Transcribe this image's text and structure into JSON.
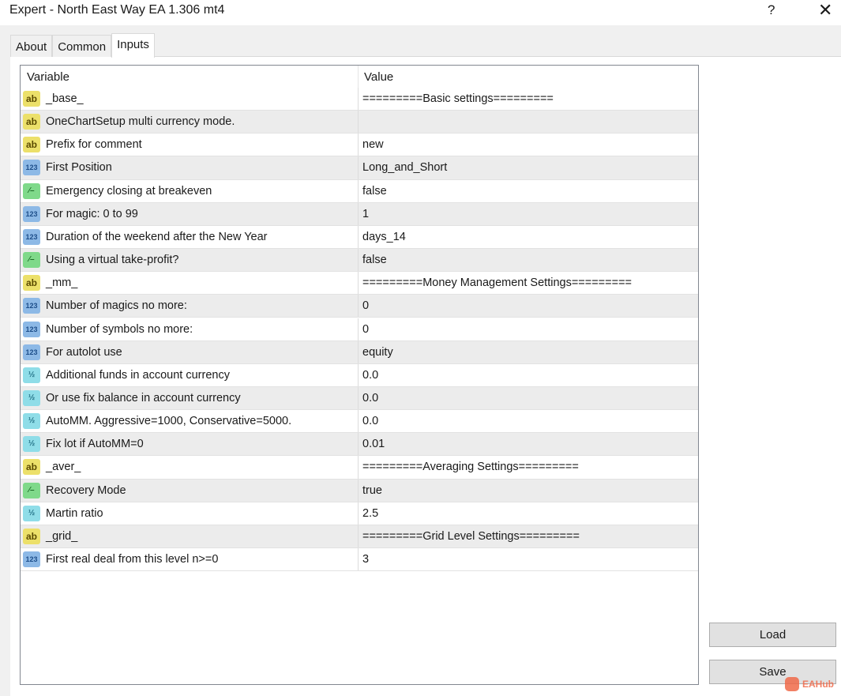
{
  "window": {
    "title": "Expert - North East Way EA 1.306 mt4",
    "help": "?",
    "close": "✕"
  },
  "tabs": [
    {
      "label": "About"
    },
    {
      "label": "Common"
    },
    {
      "label": "Inputs",
      "active": true
    }
  ],
  "grid": {
    "headers": {
      "variable": "Variable",
      "value": "Value"
    },
    "rows": [
      {
        "type": "ab",
        "variable": "_base_",
        "value": "=========Basic settings========="
      },
      {
        "type": "ab",
        "variable": "OneChartSetup multi currency mode.",
        "value": ""
      },
      {
        "type": "ab",
        "variable": "Prefix for comment",
        "value": "new"
      },
      {
        "type": "num",
        "variable": "First Position",
        "value": "Long_and_Short"
      },
      {
        "type": "bool",
        "variable": "Emergency closing at breakeven",
        "value": "false"
      },
      {
        "type": "num",
        "variable": "For magic: 0 to 99",
        "value": "1"
      },
      {
        "type": "num",
        "variable": "Duration of the weekend after the New Year",
        "value": "days_14"
      },
      {
        "type": "bool",
        "variable": "Using a virtual take-profit?",
        "value": "false"
      },
      {
        "type": "ab",
        "variable": "_mm_",
        "value": "=========Money Management Settings========="
      },
      {
        "type": "num",
        "variable": "Number of magics no more:",
        "value": "0"
      },
      {
        "type": "num",
        "variable": "Number of symbols no more:",
        "value": "0"
      },
      {
        "type": "num",
        "variable": "For autolot use",
        "value": "equity"
      },
      {
        "type": "dbl",
        "variable": "Additional funds in account currency",
        "value": "0.0"
      },
      {
        "type": "dbl",
        "variable": "Or use fix balance in account currency",
        "value": "0.0"
      },
      {
        "type": "dbl",
        "variable": "AutoMM. Aggressive=1000, Conservative=5000.",
        "value": "0.0"
      },
      {
        "type": "dbl",
        "variable": "Fix lot if AutoMM=0",
        "value": "0.01"
      },
      {
        "type": "ab",
        "variable": "_aver_",
        "value": "=========Averaging Settings========="
      },
      {
        "type": "bool",
        "variable": "Recovery Mode",
        "value": "true"
      },
      {
        "type": "dbl",
        "variable": "Martin ratio",
        "value": "2.5"
      },
      {
        "type": "ab",
        "variable": "_grid_",
        "value": "=========Grid Level Settings========="
      },
      {
        "type": "num",
        "variable": "First real deal from this level n>=0",
        "value": "3"
      }
    ]
  },
  "icon_labels": {
    "ab": "ab",
    "num": "123",
    "bool": "⁄–",
    "dbl": "½"
  },
  "buttons": {
    "load": "Load",
    "save": "Save"
  },
  "watermark": "EAHub"
}
